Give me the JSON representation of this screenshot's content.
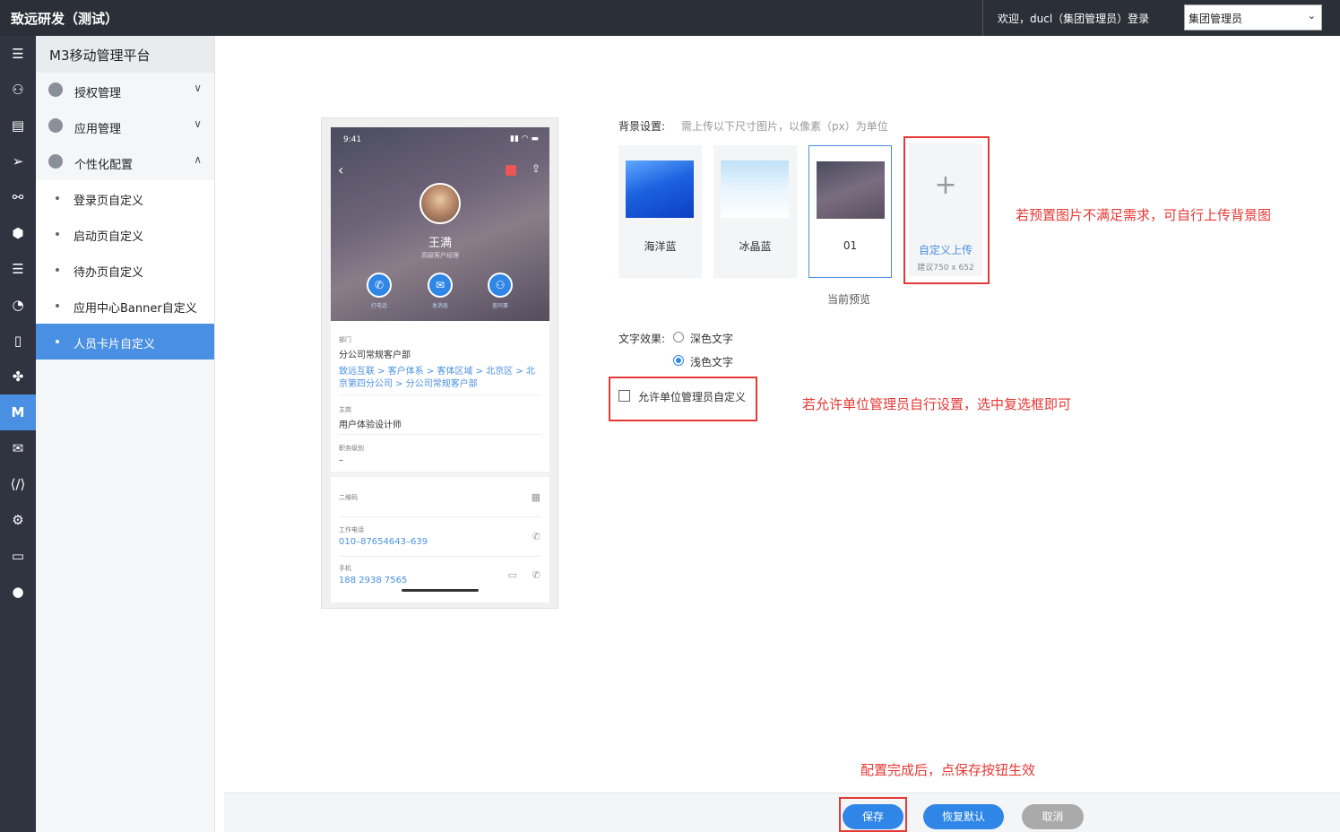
{
  "app": {
    "title": "致远研发（测试）",
    "welcome": "欢迎，ducl（集团管理员）登录",
    "role_select": "集团管理员"
  },
  "sidebar": {
    "header": "M3移动管理平台",
    "groups": [
      {
        "label": "授权管理",
        "icon": "gear-icon"
      },
      {
        "label": "应用管理",
        "icon": "cubes-icon"
      },
      {
        "label": "个性化配置",
        "icon": "palette-icon"
      }
    ],
    "sub_items": [
      {
        "label": "登录页自定义"
      },
      {
        "label": "启动页自定义"
      },
      {
        "label": "待办页自定义"
      },
      {
        "label": "应用中心Banner自定义"
      },
      {
        "label": "人员卡片自定义"
      }
    ]
  },
  "iconbar": [
    "menu-icon",
    "org-icon",
    "list-icon",
    "send-icon",
    "link-icon",
    "cube-icon",
    "server-icon",
    "gauge-icon",
    "doc-icon",
    "apps-icon",
    "m-icon",
    "chat-icon",
    "code-icon",
    "settings-icon",
    "monitor-icon",
    "user-icon"
  ],
  "preview": {
    "time": "9:41",
    "name": "王满",
    "title": "高级客户经理",
    "actions": [
      "打电话",
      "发消息",
      "查同事"
    ],
    "dept_label": "部门",
    "dept_value": "分公司常规客户部",
    "dept_path": "致远互联 > 客户体系 > 客体区域 > 北京区 > 北京第四分公司 > 分公司常规客户部",
    "post_label": "主岗",
    "post_value": "用户体验设计师",
    "level_label": "职务级别",
    "level_value": "–",
    "qr_label": "二维码",
    "work_phone_label": "工作电话",
    "work_phone": "010–87654643–639",
    "mobile_label": "手机",
    "mobile": "188 2938 7565"
  },
  "settings": {
    "bg_label": "背景设置:",
    "bg_hint": "需上传以下尺寸图片，以像素（px）为单位",
    "backgrounds": [
      {
        "label": "海洋蓝"
      },
      {
        "label": "冰晶蓝"
      },
      {
        "label": "01"
      }
    ],
    "current_preview": "当前预览",
    "upload_label": "自定义上传",
    "upload_hint": "建议750 x 652",
    "text_effect_label": "文字效果:",
    "text_options": [
      "深色文字",
      "浅色文字"
    ],
    "allow_custom_label": "允许单位管理员自定义"
  },
  "annotations": {
    "upload_note": "若预置图片不满足需求，可自行上传背景图",
    "checkbox_note": "若允许单位管理员自行设置，选中复选框即可",
    "save_note": "配置完成后，点保存按钮生效"
  },
  "footer": {
    "save": "保存",
    "reset": "恢复默认",
    "cancel": "取消"
  },
  "colors": {
    "accent": "#4a90e2",
    "annotation_red": "#e53935",
    "topbar": "#2b2f38"
  }
}
